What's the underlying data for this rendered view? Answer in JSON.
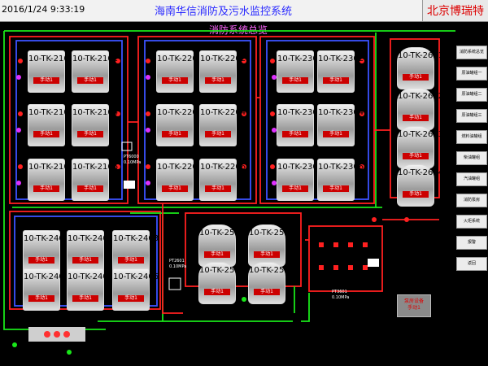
{
  "header": {
    "datetime": "2016/1/24 9:33:19",
    "title": "海南华信消防及污水监控系统",
    "brand": "北京博瑞特"
  },
  "overview_label": "消防系统总览",
  "tanks": [
    {
      "id": "10-TK-2101",
      "manual": "手动1"
    },
    {
      "id": "10-TK-2102",
      "manual": "手动1"
    },
    {
      "id": "10-TK-2103",
      "manual": "手动1"
    },
    {
      "id": "10-TK-2104",
      "manual": "手动1"
    },
    {
      "id": "10-TK-2105",
      "manual": "手动1"
    },
    {
      "id": "10-TK-2106",
      "manual": "手动1"
    },
    {
      "id": "10-TK-2201",
      "manual": "手动1"
    },
    {
      "id": "10-TK-2202",
      "manual": "手动1"
    },
    {
      "id": "10-TK-2203",
      "manual": "手动1"
    },
    {
      "id": "10-TK-2204",
      "manual": "手动1"
    },
    {
      "id": "10-TK-2205",
      "manual": "手动1"
    },
    {
      "id": "10-TK-2206",
      "manual": "手动1"
    },
    {
      "id": "10-TK-2301",
      "manual": "手动1"
    },
    {
      "id": "10-TK-2302",
      "manual": "手动1"
    },
    {
      "id": "10-TK-2303",
      "manual": "手动1"
    },
    {
      "id": "10-TK-2304",
      "manual": "手动1"
    },
    {
      "id": "10-TK-2305",
      "manual": "手动1"
    },
    {
      "id": "10-TK-2306",
      "manual": "手动1"
    },
    {
      "id": "10-TK-2401",
      "manual": "手动1"
    },
    {
      "id": "10-TK-2402",
      "manual": "手动1"
    },
    {
      "id": "10-TK-2403",
      "manual": "手动1"
    },
    {
      "id": "10-TK-2404",
      "manual": "手动1"
    },
    {
      "id": "10-TK-2405",
      "manual": "手动1"
    },
    {
      "id": "10-TK-2406",
      "manual": "手动1"
    },
    {
      "id": "10-TK-2501",
      "manual": "手动1"
    },
    {
      "id": "10-TK-2502",
      "manual": "手动1"
    },
    {
      "id": "10-TK-2503",
      "manual": "手动1"
    },
    {
      "id": "10-TK-2504",
      "manual": "手动1"
    },
    {
      "id": "10-TK-2601",
      "manual": "手动1"
    },
    {
      "id": "10-TK-2602",
      "manual": "手动1"
    },
    {
      "id": "10-TK-2603",
      "manual": "手动1"
    },
    {
      "id": "10-TK-2604",
      "manual": "手动1"
    }
  ],
  "nav": [
    "消防系统总览",
    "原油罐组一",
    "原油罐组二",
    "原油罐组三",
    "燃料油罐组",
    "柴油罐组",
    "汽油罐组",
    "消防泵房",
    "火炬系统",
    "报警",
    "返回"
  ],
  "alarm_box": {
    "line1": "泵房设备",
    "line2": "手动1"
  },
  "pressure_labels": {
    "pt_a": "PT2601",
    "pt_a_value": "0.10MPa",
    "pt_b": "PT6000",
    "pt_b_value": "0.10MPa",
    "pt_c": "PT3601",
    "pt_c_value": "0.10MPa"
  },
  "colors": {
    "bg": "#000000",
    "pipe_red": "#ff2020",
    "pipe_green": "#19e619",
    "pipe_blue": "#3b53ff",
    "brand": "#dd0000"
  }
}
